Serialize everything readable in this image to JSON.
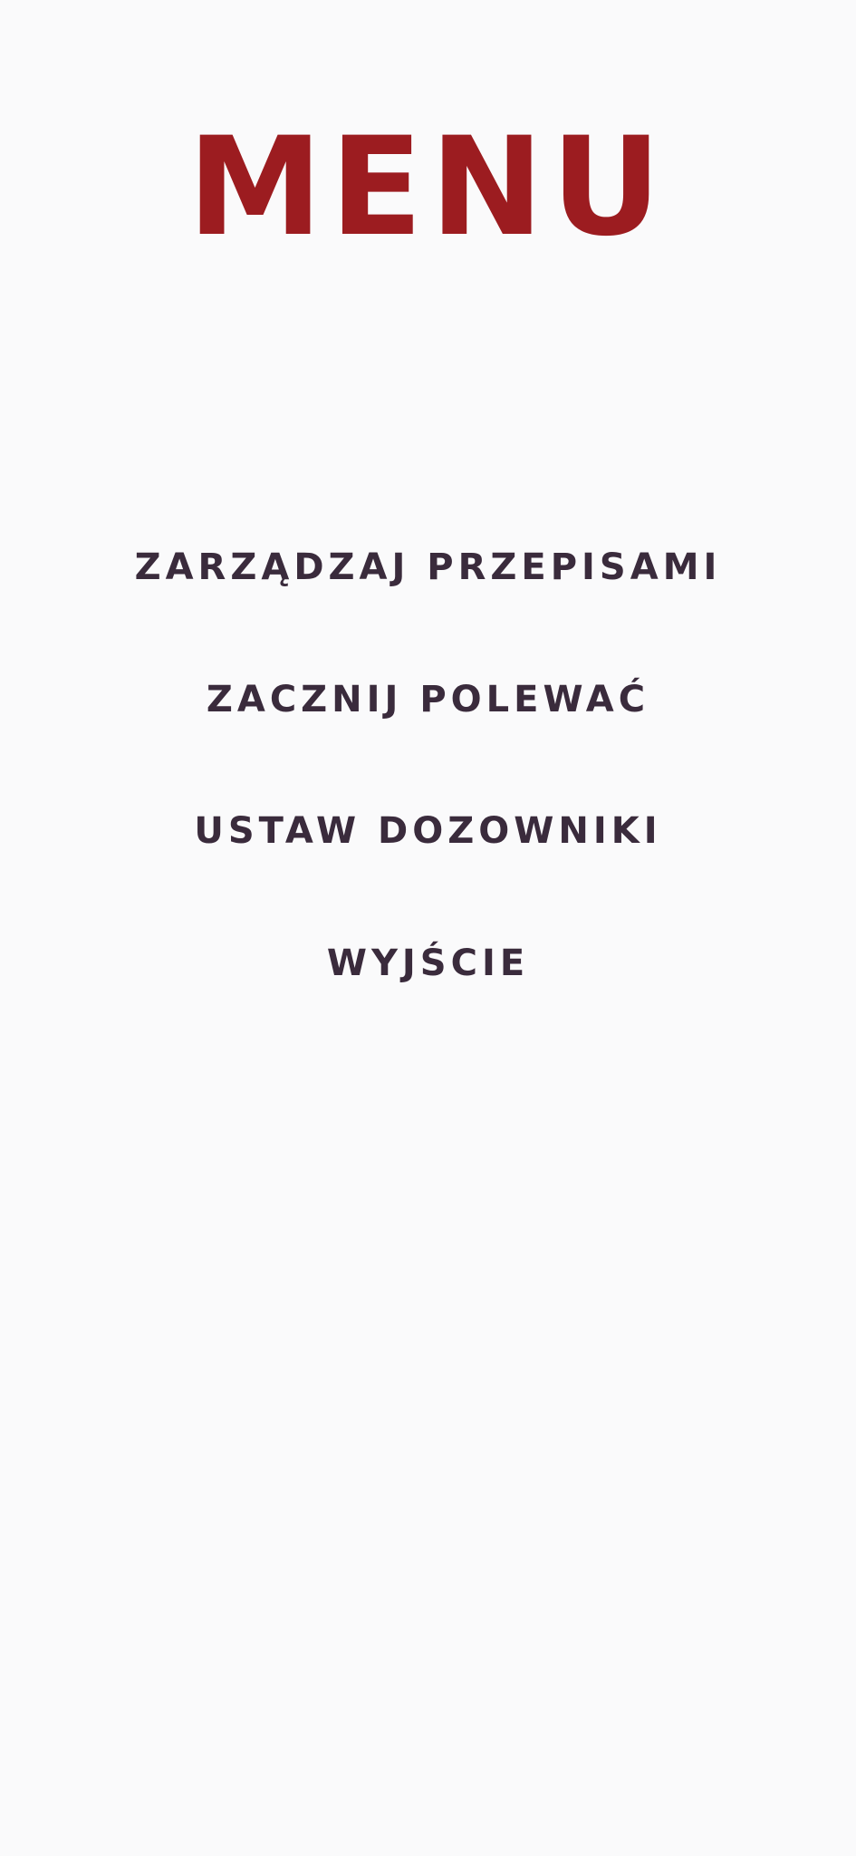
{
  "menu": {
    "title": "MENU",
    "items": [
      "ZARZĄDZAJ PRZEPISAMI",
      "ZACZNIJ POLEWAĆ",
      "USTAW DOZOWNIKI",
      "WYJŚCIE"
    ]
  },
  "colors": {
    "background": "#fafafb",
    "title": "#9c1c20",
    "item_text": "#3a2b3c"
  }
}
